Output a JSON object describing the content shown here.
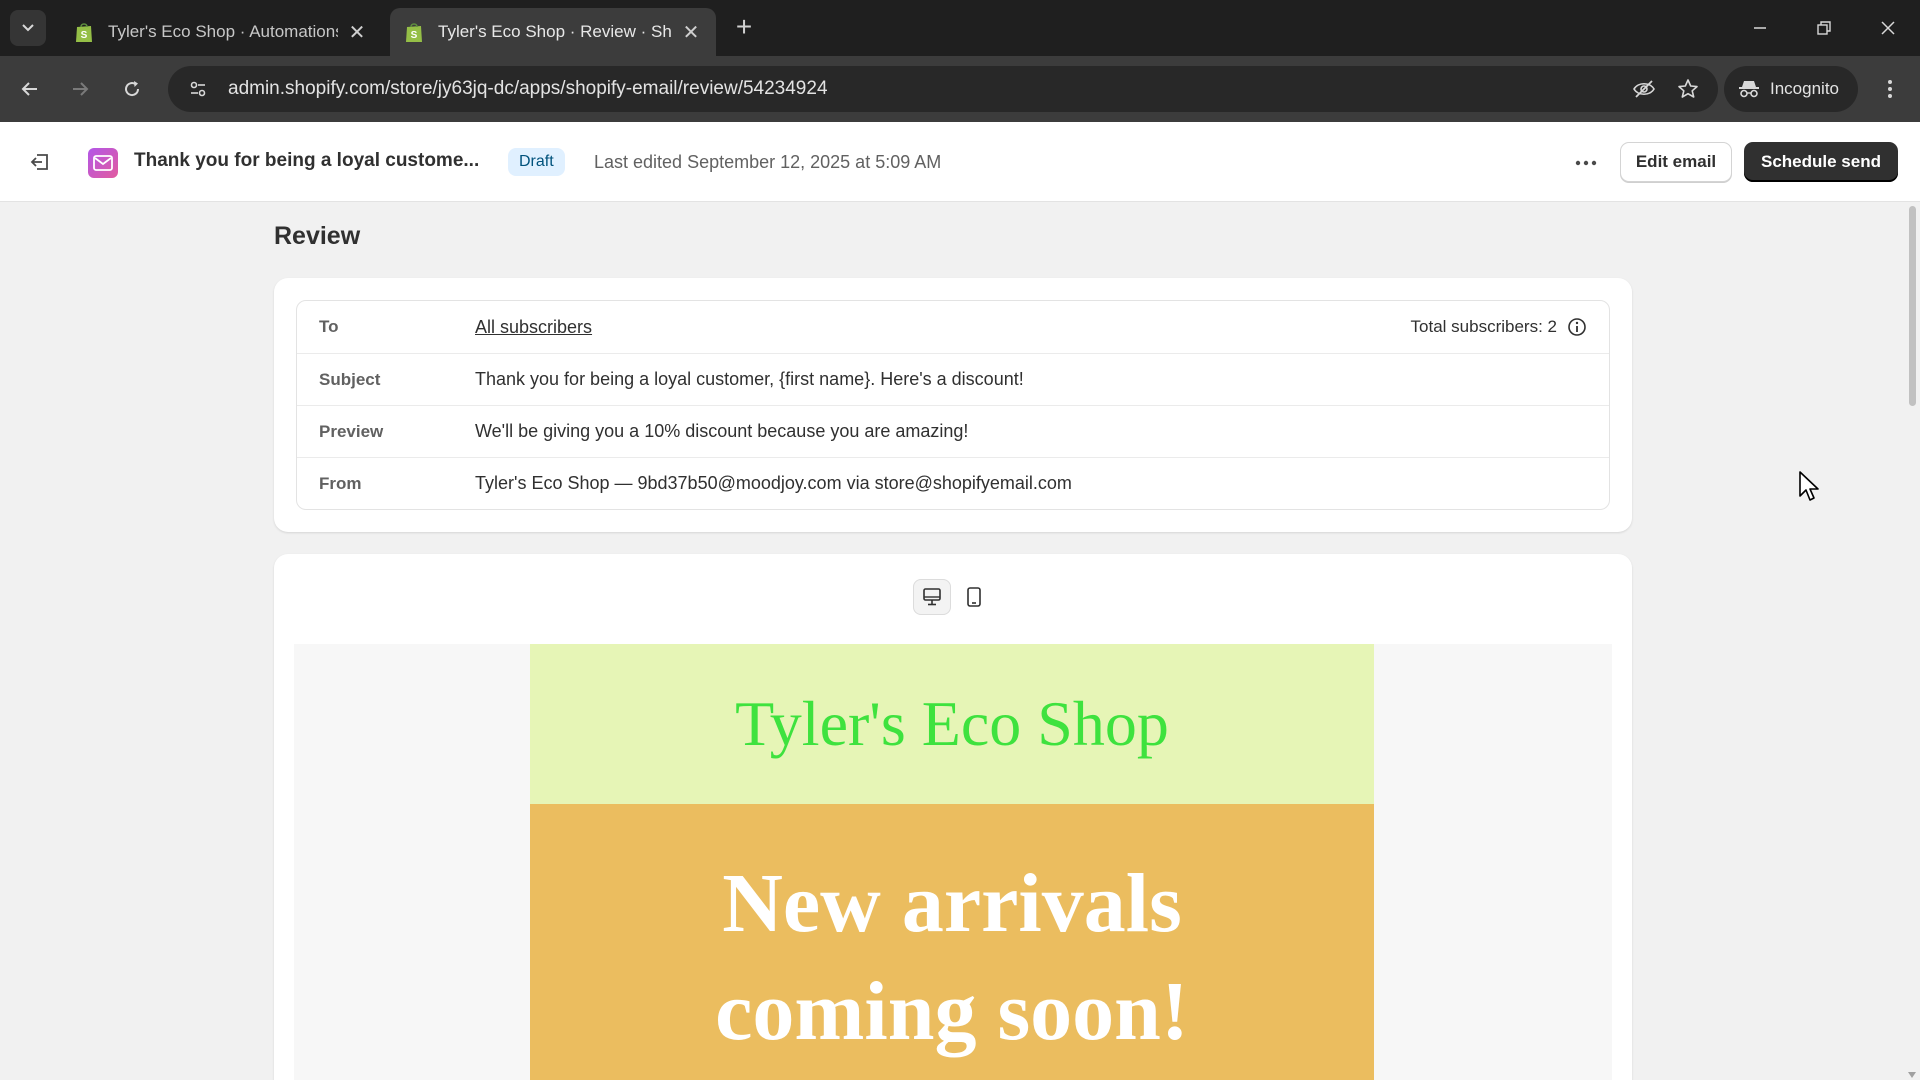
{
  "browser": {
    "tabs": [
      {
        "title": "Tyler's Eco Shop · Automations",
        "active": false
      },
      {
        "title": "Tyler's Eco Shop · Review · Shopify",
        "active": true
      }
    ],
    "url": "admin.shopify.com/store/jy63jq-dc/apps/shopify-email/review/54234924",
    "incognito_label": "Incognito",
    "tab_close_glyph": "✕",
    "new_tab_glyph": "+"
  },
  "header": {
    "email_title": "Thank you for being a loyal custome...",
    "status_badge": "Draft",
    "last_edited": "Last edited September 12, 2025 at 5:09 AM",
    "edit_label": "Edit email",
    "schedule_label": "Schedule send"
  },
  "review": {
    "heading": "Review",
    "to_label": "To",
    "to_value": "All subscribers",
    "total_subscribers": "Total subscribers: 2",
    "subject_label": "Subject",
    "subject_value": "Thank you for being a loyal customer, {first name}. Here's a discount!",
    "preview_label": "Preview",
    "preview_value": "We'll be giving you a 10% discount because you are amazing!",
    "from_label": "From",
    "from_value": "Tyler's Eco Shop — 9bd37b50@moodjoy.com via store@shopifyemail.com"
  },
  "email_preview": {
    "shop_name": "Tyler's Eco Shop",
    "hero_line1": "New arrivals",
    "hero_line2": "coming soon!",
    "header_bg": "#e6f5b6",
    "shop_name_color": "#3ee23e",
    "hero_bg": "#ebbd5f"
  },
  "colors": {
    "primary_button": "#303030",
    "draft_badge_bg": "#e0f0ff",
    "draft_badge_text": "#00527c",
    "shopify_green": "#95bf47"
  },
  "icons": {
    "tab_favicon": "shopify-bag-icon",
    "exit": "exit-icon",
    "email_app": "mail-icon",
    "more": "more-horizontal-icon",
    "info": "info-icon",
    "desktop_view": "desktop-icon",
    "mobile_view": "mobile-icon"
  }
}
